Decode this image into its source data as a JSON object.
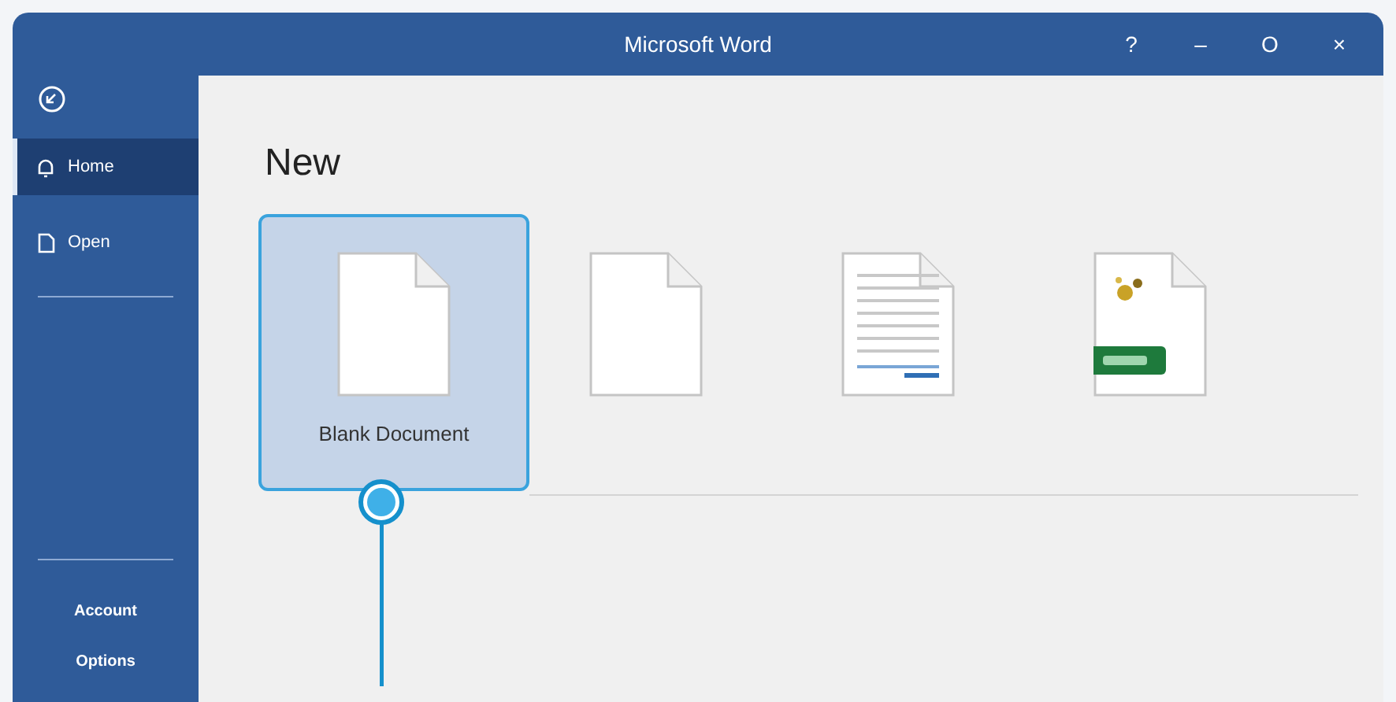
{
  "window": {
    "title": "Microsoft Word",
    "controls": [
      "?",
      "–",
      "O",
      "×"
    ]
  },
  "sidebar": {
    "items": [
      {
        "label": "Home",
        "selected": true
      },
      {
        "label": "Open",
        "selected": false
      }
    ],
    "bottom_items": [
      "Account",
      "Options"
    ]
  },
  "heading": "New",
  "templates": [
    {
      "kind": "blank",
      "label": "Blank Document",
      "selected": true
    },
    {
      "kind": "blank",
      "selected": false
    },
    {
      "kind": "lined",
      "selected": false
    },
    {
      "kind": "image",
      "selected": false
    }
  ]
}
